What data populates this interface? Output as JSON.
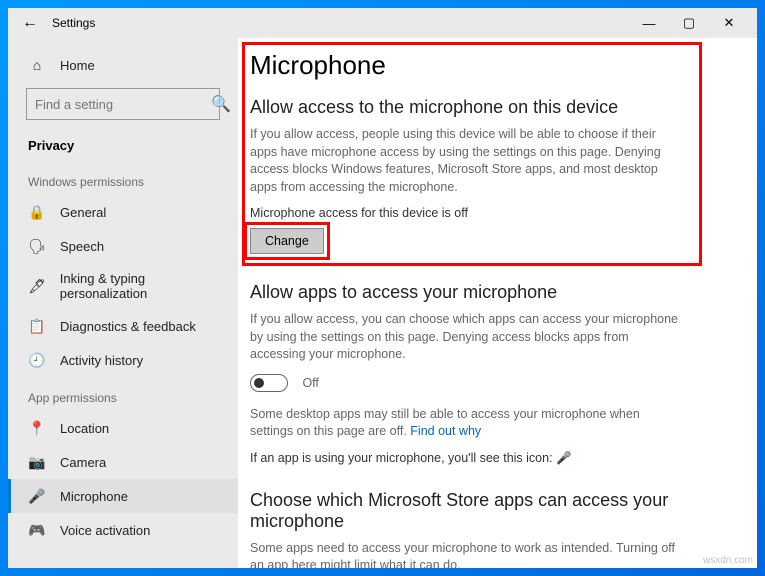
{
  "titlebar": {
    "back": "←",
    "title": "Settings",
    "min": "—",
    "max": "▢",
    "close": "✕"
  },
  "sidebar": {
    "home": "Home",
    "search_placeholder": "Find a setting",
    "privacy": "Privacy",
    "group_win": "Windows permissions",
    "items_win": [
      {
        "icon": "🔒",
        "label": "General"
      },
      {
        "icon": "🗣",
        "label": "Speech"
      },
      {
        "icon": "🖋",
        "label": "Inking & typing personalization"
      },
      {
        "icon": "📋",
        "label": "Diagnostics & feedback"
      },
      {
        "icon": "🕘",
        "label": "Activity history"
      }
    ],
    "group_app": "App permissions",
    "items_app": [
      {
        "icon": "📍",
        "label": "Location"
      },
      {
        "icon": "📷",
        "label": "Camera"
      },
      {
        "icon": "🎤",
        "label": "Microphone",
        "active": true
      },
      {
        "icon": "🎮",
        "label": "Voice activation"
      }
    ]
  },
  "main": {
    "h1": "Microphone",
    "section1": {
      "h2": "Allow access to the microphone on this device",
      "p": "If you allow access, people using this device will be able to choose if their apps have microphone access by using the settings on this page. Denying access blocks Windows features, Microsoft Store apps, and most desktop apps from accessing the microphone.",
      "status": "Microphone access for this device is off",
      "button": "Change"
    },
    "section2": {
      "h2": "Allow apps to access your microphone",
      "p": "If you allow access, you can choose which apps can access your microphone by using the settings on this page. Denying access blocks apps from accessing your microphone.",
      "toggle": "Off",
      "p2a": "Some desktop apps may still be able to access your microphone when settings on this page are off. ",
      "link": "Find out why",
      "p3": "If an app is using your microphone, you'll see this icon: 🎤"
    },
    "section3": {
      "h2": "Choose which Microsoft Store apps can access your microphone",
      "p": "Some apps need to access your microphone to work as intended. Turning off an app here might limit what it can do."
    }
  },
  "watermark": "wsxdn.com"
}
